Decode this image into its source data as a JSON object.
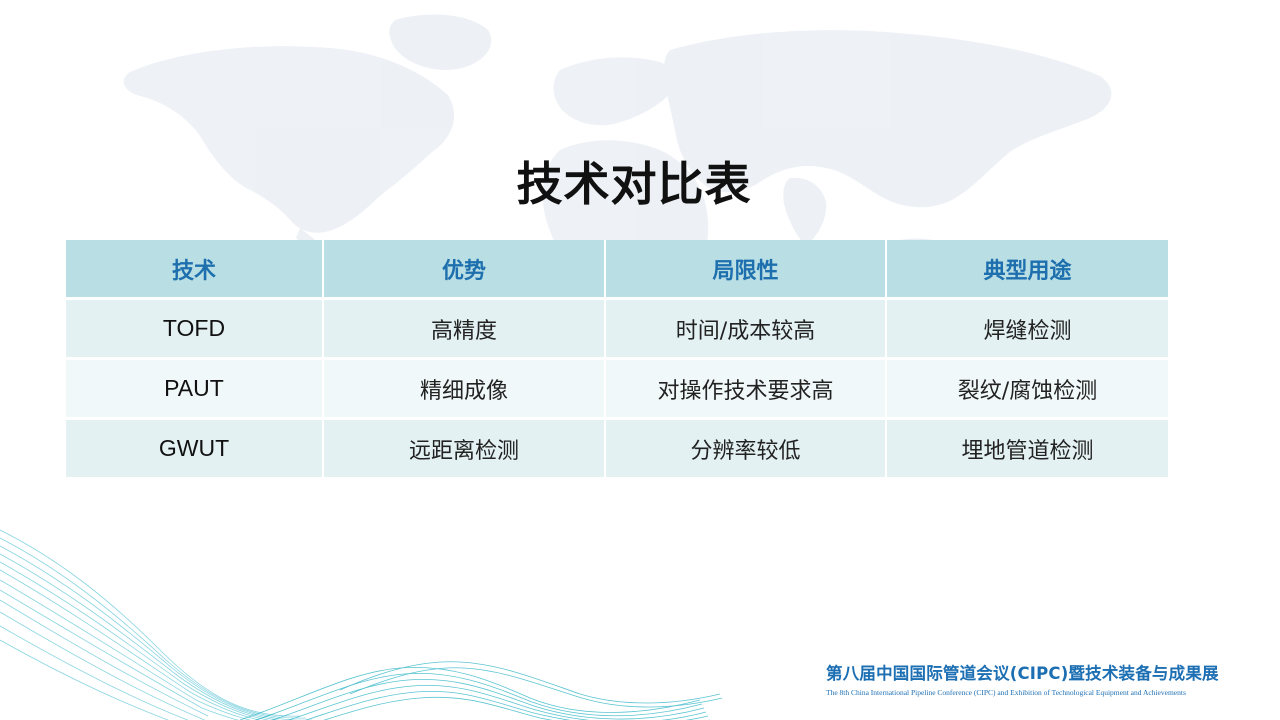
{
  "slide": {
    "title": "技术对比表"
  },
  "table": {
    "headers": [
      "技术",
      "优势",
      "局限性",
      "典型用途"
    ],
    "rows": [
      [
        "TOFD",
        "高精度",
        "时间/成本较高",
        "焊缝检测"
      ],
      [
        "PAUT",
        "精细成像",
        "对操作技术要求高",
        "裂纹/腐蚀检测"
      ],
      [
        "GWUT",
        "远距离检测",
        "分辨率较低",
        "埋地管道检测"
      ]
    ]
  },
  "footer": {
    "title_cn": "第八届中国国际管道会议(CIPC)暨技术装备与成果展",
    "title_en": "The 8th China International Pipeline Conference (CIPC) and Exhibition of Technological Equipment and Achievements"
  },
  "colors": {
    "header_bg": "#b9dfe4",
    "header_text": "#1e6fae",
    "row_bg_odd": "#e3f1f3",
    "row_bg_even": "#f1f8f9",
    "footer_text": "#1d6fb3",
    "wave_color": "#2bb3c9"
  },
  "icons": {
    "background_map": "world-map-watermark",
    "background_waves": "decorative-wave-lines"
  }
}
